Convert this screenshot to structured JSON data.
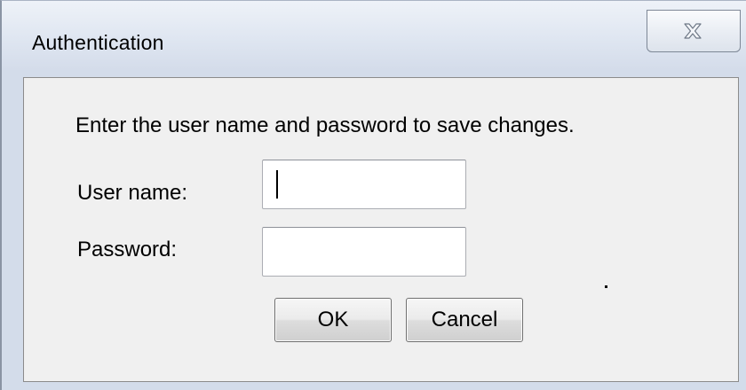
{
  "window": {
    "title": "Authentication"
  },
  "dialog": {
    "instruction": "Enter the user name and password to save changes.",
    "username_label": "User name:",
    "username_value": "",
    "password_label": "Password:",
    "password_value": "",
    "ok_label": "OK",
    "cancel_label": "Cancel"
  },
  "icons": {
    "close": "close-icon"
  },
  "colors": {
    "title_bar": "#dfe6f1",
    "client_background": "#f0f0f0",
    "input_background": "#ffffff"
  }
}
